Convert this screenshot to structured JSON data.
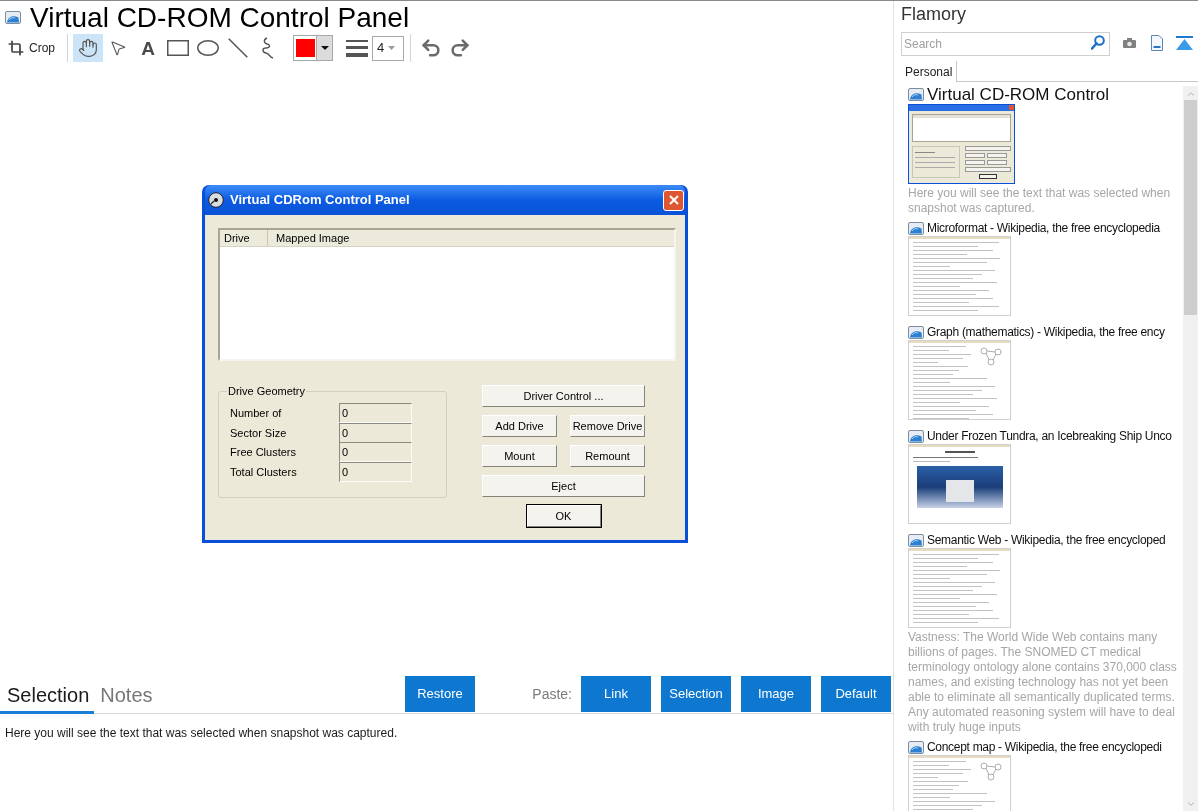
{
  "window": {
    "title": "Virtual CD-ROM Control Panel"
  },
  "toolbar": {
    "tools": [
      {
        "kind": "crop",
        "label": "Crop",
        "selected": false
      },
      {
        "kind": "hand",
        "selected": true
      },
      {
        "kind": "pointer",
        "selected": false
      },
      {
        "kind": "text",
        "label": "A",
        "selected": false
      },
      {
        "kind": "rectangle",
        "selected": false
      },
      {
        "kind": "ellipse",
        "selected": false
      },
      {
        "kind": "line",
        "selected": false
      },
      {
        "kind": "freehand",
        "selected": false
      }
    ],
    "color_picker": {
      "color": "#ff0000"
    },
    "line_width": {
      "value": "4"
    }
  },
  "canvas": {
    "dialog": {
      "title": "Virtual CDRom Control Panel",
      "columns": [
        "Drive",
        "Mapped Image"
      ],
      "group": {
        "title": "Drive Geometry",
        "fields": [
          {
            "label": "Number of",
            "value": "0"
          },
          {
            "label": "Sector Size",
            "value": "0"
          },
          {
            "label": "Free Clusters",
            "value": "0"
          },
          {
            "label": "Total Clusters",
            "value": "0"
          }
        ]
      },
      "buttons": [
        {
          "label": "Driver Control ...",
          "kind": "wide"
        },
        {
          "label": "Add Drive",
          "kind": "half"
        },
        {
          "label": "Remove Drive",
          "kind": "half"
        },
        {
          "label": "Mount",
          "kind": "half"
        },
        {
          "label": "Remount",
          "kind": "half"
        },
        {
          "label": "Eject",
          "kind": "wide"
        },
        {
          "label": "OK",
          "kind": "default"
        }
      ]
    }
  },
  "notes_panel": {
    "tabs": [
      {
        "label": "Selection",
        "selected": true
      },
      {
        "label": "Notes",
        "selected": false
      }
    ],
    "restore_button": "Restore",
    "paste_label": "Paste:",
    "paste_buttons": [
      "Link",
      "Selection",
      "Image",
      "Default"
    ],
    "text": "Here you will see the text that was selected when snapshot was captured."
  },
  "sidebar": {
    "title": "Flamory",
    "search": {
      "placeholder": "Search"
    },
    "tabs": [
      {
        "label": "Personal",
        "selected": true
      }
    ],
    "items": [
      {
        "title": "Virtual CD-ROM Control",
        "current": true,
        "kind": "dialog",
        "description": "Here you will see the text that was selected when snapshot was captured."
      },
      {
        "title": "Microformat - Wikipedia, the free encyclopedia",
        "current": false,
        "kind": "text"
      },
      {
        "title": "Graph (mathematics) - Wikipedia, the free ency",
        "current": false,
        "kind": "diagram"
      },
      {
        "title": "Under Frozen Tundra, an Icebreaking Ship Unco",
        "current": false,
        "kind": "photo"
      },
      {
        "title": "Semantic Web - Wikipedia, the free encycloped",
        "current": false,
        "kind": "text",
        "description": "Vastness: The World Wide Web contains many billions of pages. The SNOMED CT medical terminology ontology alone contains 370,000 class names, and existing technology has not yet been able to eliminate all semantically duplicated terms. Any automated reasoning system will have to deal with truly huge inputs"
      },
      {
        "title": "Concept map - Wikipedia, the free encyclopedi",
        "current": false,
        "kind": "diagram"
      }
    ]
  }
}
